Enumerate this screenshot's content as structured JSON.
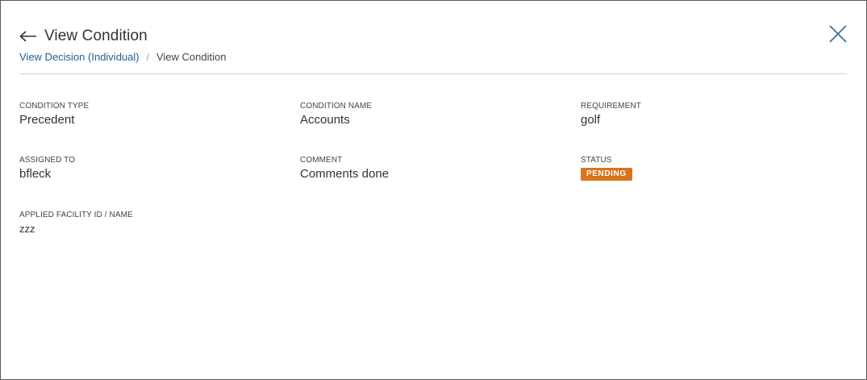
{
  "header": {
    "title": "View Condition",
    "back_icon": "arrow-left-icon",
    "close_icon": "close-icon"
  },
  "breadcrumb": {
    "items": [
      {
        "label": "View Decision (Individual)"
      },
      {
        "label": "View Condition"
      }
    ],
    "separator": "/"
  },
  "fields": {
    "condition_type": {
      "label": "CONDITION TYPE",
      "value": "Precedent"
    },
    "condition_name": {
      "label": "CONDITION NAME",
      "value": "Accounts"
    },
    "requirement": {
      "label": "REQUIREMENT",
      "value": "golf"
    },
    "assigned_to": {
      "label": "ASSIGNED TO",
      "value": "bfleck"
    },
    "comment": {
      "label": "COMMENT",
      "value": "Comments done"
    },
    "status": {
      "label": "STATUS",
      "value": "PENDING"
    },
    "applied_facility": {
      "label": "APPLIED FACILITY ID / NAME",
      "value": "zzz"
    }
  },
  "colors": {
    "link": "#1f5f94",
    "status_pending": "#d9731e",
    "close_icon": "#3d6f99"
  }
}
